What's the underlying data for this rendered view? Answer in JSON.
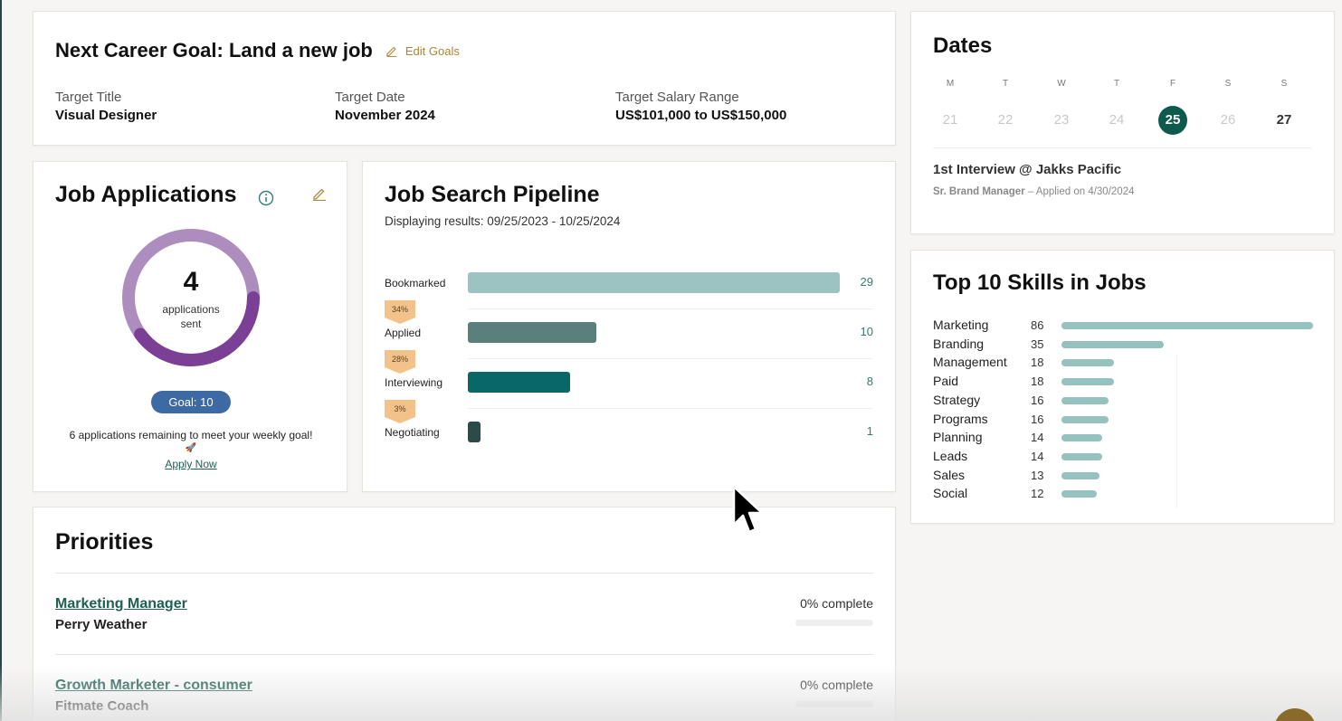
{
  "goal": {
    "title": "Next Career Goal: Land a new job",
    "edit_label": "Edit Goals",
    "target_title_label": "Target Title",
    "target_title": "Visual Designer",
    "target_date_label": "Target Date",
    "target_date": "November 2024",
    "salary_label": "Target Salary Range",
    "salary": "US$101,000 to US$150,000"
  },
  "dates": {
    "title": "Dates",
    "days": [
      {
        "dow": "M",
        "num": "21"
      },
      {
        "dow": "T",
        "num": "22"
      },
      {
        "dow": "W",
        "num": "23"
      },
      {
        "dow": "T",
        "num": "24"
      },
      {
        "dow": "F",
        "num": "25"
      },
      {
        "dow": "S",
        "num": "26"
      },
      {
        "dow": "S",
        "num": "27"
      }
    ],
    "active_day": "25",
    "event_title": "1st Interview @ Jakks Pacific",
    "event_role": "Sr. Brand Manager",
    "event_meta": " – Applied on 4/30/2024"
  },
  "applications": {
    "title": "Job Applications",
    "count": "4",
    "count_label_1": "applications",
    "count_label_2": "sent",
    "goal_pill": "Goal: 10",
    "progress_fraction": 0.4,
    "remaining_text": "6 applications remaining to meet your weekly goal!",
    "rocket": "🚀",
    "apply_link": "Apply Now",
    "colors": {
      "ring_bg": "#ad8cbe",
      "ring_fg": "#7b3f95"
    }
  },
  "pipeline": {
    "title": "Job Search Pipeline",
    "subtitle": "Displaying results: 09/25/2023 - 10/25/2024",
    "stages": [
      {
        "label": "Bookmarked",
        "value": 29,
        "color": "#9cc3c1"
      },
      {
        "label": "Applied",
        "value": 10,
        "color": "#5b7f7b"
      },
      {
        "label": "Interviewing",
        "value": 8,
        "color": "#0a6767"
      },
      {
        "label": "Negotiating",
        "value": 1,
        "color": "#2b4a48"
      }
    ],
    "conversions": [
      "34%",
      "28%",
      "3%"
    ],
    "max": 29
  },
  "skills": {
    "title": "Top 10 Skills in Jobs",
    "items": [
      {
        "name": "Marketing",
        "value": 86
      },
      {
        "name": "Branding",
        "value": 35
      },
      {
        "name": "Management",
        "value": 18
      },
      {
        "name": "Paid",
        "value": 18
      },
      {
        "name": "Strategy",
        "value": 16
      },
      {
        "name": "Programs",
        "value": 16
      },
      {
        "name": "Planning",
        "value": 14
      },
      {
        "name": "Leads",
        "value": 14
      },
      {
        "name": "Sales",
        "value": 13
      },
      {
        "name": "Social",
        "value": 12
      }
    ],
    "max": 86
  },
  "priorities": {
    "title": "Priorities",
    "items": [
      {
        "title": "Marketing Manager",
        "company": "Perry Weather",
        "progress": "0% complete"
      },
      {
        "title": "Growth Marketer - consumer",
        "company": "Fitmate Coach",
        "progress": "0% complete"
      }
    ]
  }
}
